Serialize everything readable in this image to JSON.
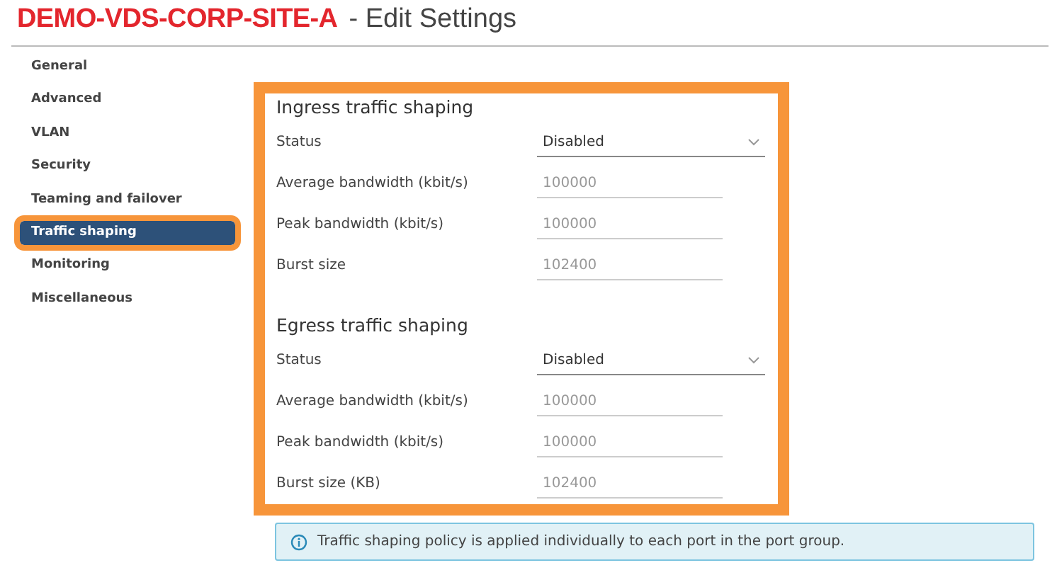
{
  "header": {
    "object_name": "DEMO-VDS-CORP-SITE-A",
    "title": "- Edit Settings"
  },
  "sidebar": {
    "items": [
      {
        "label": "General",
        "selected": false,
        "highlighted": false
      },
      {
        "label": "Advanced",
        "selected": false,
        "highlighted": false
      },
      {
        "label": "VLAN",
        "selected": false,
        "highlighted": false
      },
      {
        "label": "Security",
        "selected": false,
        "highlighted": false
      },
      {
        "label": "Teaming and failover",
        "selected": false,
        "highlighted": false
      },
      {
        "label": "Traffic shaping",
        "selected": true,
        "highlighted": true
      },
      {
        "label": "Monitoring",
        "selected": false,
        "highlighted": false
      },
      {
        "label": "Miscellaneous",
        "selected": false,
        "highlighted": false
      }
    ]
  },
  "form": {
    "highlighted": true,
    "sections": [
      {
        "title": "Ingress traffic shaping",
        "fields": [
          {
            "kind": "select",
            "label": "Status",
            "value": "Disabled"
          },
          {
            "kind": "input",
            "label": "Average bandwidth (kbit/s)",
            "value": "100000",
            "disabled": true
          },
          {
            "kind": "input",
            "label": "Peak bandwidth (kbit/s)",
            "value": "100000",
            "disabled": true
          },
          {
            "kind": "input",
            "label": "Burst size",
            "value": "102400",
            "disabled": true
          }
        ]
      },
      {
        "title": "Egress traffic shaping",
        "fields": [
          {
            "kind": "select",
            "label": "Status",
            "value": "Disabled"
          },
          {
            "kind": "input",
            "label": "Average bandwidth (kbit/s)",
            "value": "100000",
            "disabled": true
          },
          {
            "kind": "input",
            "label": "Peak bandwidth (kbit/s)",
            "value": "100000",
            "disabled": true
          },
          {
            "kind": "input",
            "label": "Burst size (KB)",
            "value": "102400",
            "disabled": true
          }
        ]
      }
    ]
  },
  "info": {
    "text": "Traffic shaping policy is applied individually to each port in the port group."
  }
}
